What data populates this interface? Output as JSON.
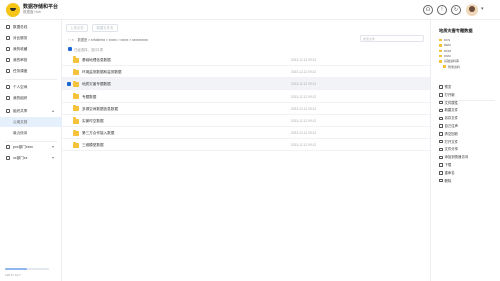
{
  "app": {
    "title": "数据存储和平台",
    "subtitle": "数据盘 Hub"
  },
  "top_icons": [
    "headset-icon",
    "info-icon",
    "refresh-icon"
  ],
  "sidebar": {
    "items": [
      {
        "label": "数据总线",
        "icon": "database-icon"
      },
      {
        "label": "对比服务",
        "icon": "compare-icon"
      },
      {
        "label": "我的收藏",
        "icon": "star-icon"
      },
      {
        "label": "我的审批",
        "icon": "approval-icon"
      },
      {
        "label": "任务调度",
        "icon": "task-icon"
      }
    ],
    "items2": [
      {
        "label": "个人空间",
        "icon": "user-icon"
      },
      {
        "label": "我的组织",
        "icon": "team-icon"
      }
    ],
    "group": {
      "label": "组织共享",
      "icon": "share-icon",
      "arrow": "▴"
    },
    "subitems": [
      "公用文档",
      "最近使用"
    ],
    "workspaces": [
      {
        "label": "pxx部门xxxx",
        "arrow": "▾"
      },
      {
        "label": "xx部门xx",
        "arrow": "▾"
      }
    ],
    "storage": {
      "text": "128.5 / 10.7",
      "used_fraction": 0.5
    }
  },
  "toolbar": {
    "upload_label": "上传文件",
    "new_folder_label": "新建文件夹"
  },
  "breadcrumb": {
    "nav": "‹ › ↻",
    "path": "数据盘 > xxfolderxx > xxxxx > xxxxx > xxxxxxxxxx"
  },
  "search": {
    "placeholder": "搜索文件"
  },
  "list": {
    "select_all_label": "已经选择，选中1项",
    "rows": [
      {
        "name": "基础地理信息数据",
        "date": "2023-12-12 09:12",
        "selected": false
      },
      {
        "name": "环境监测数据和监测数据",
        "date": "2023-12-12 09:12",
        "selected": false
      },
      {
        "name": "地质灾害专题数据",
        "date": "2023-12-12 09:12",
        "selected": true
      },
      {
        "name": "专题数据",
        "date": "2023-12-12 09:12",
        "selected": false
      },
      {
        "name": "多源空间数据信息数据",
        "date": "2023-12-12 09:12",
        "selected": false
      },
      {
        "name": "实景时空数据",
        "date": "2023-12-12 09:12",
        "selected": false
      },
      {
        "name": "第三方合作接入数据",
        "date": "2023-12-12 09:12",
        "selected": false
      },
      {
        "name": "三维模型数据",
        "date": "2023-12-12 09:12",
        "selected": false
      }
    ]
  },
  "right_panel": {
    "title": "地质灾害专题数据",
    "tree": [
      "DVS",
      "DEM",
      "DOM",
      "DSM",
      "基础资料库",
      "附录资料"
    ],
    "actions": [
      "预览",
      "打开新",
      "文件属性",
      "新建文件",
      "另存文件",
      "自己往声",
      "清空回收",
      "打开文件",
      "文件分享",
      "添加到快速访问",
      "下载",
      "重命名",
      "删除"
    ]
  },
  "colors": {
    "accent": "#1b66d2",
    "folder": "#f4c33b",
    "logo": "#f5c518"
  }
}
